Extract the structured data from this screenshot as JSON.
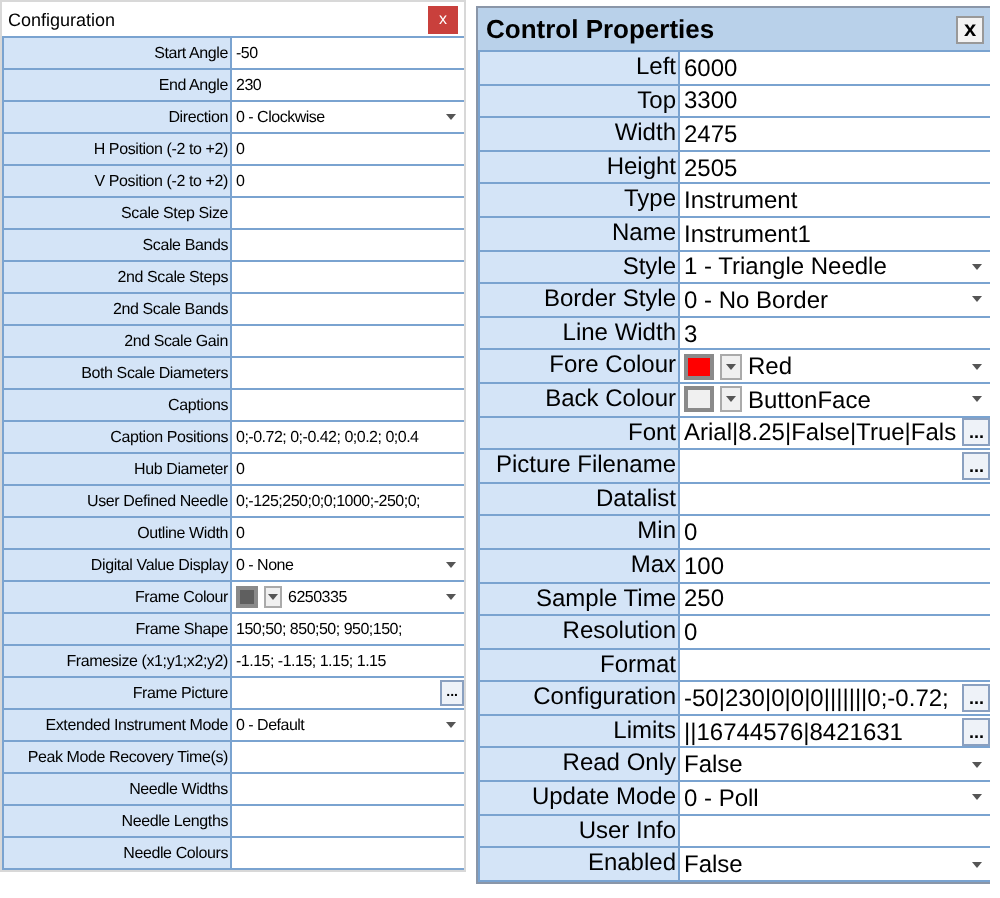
{
  "configuration": {
    "title": "Configuration",
    "close": "x",
    "rows": [
      {
        "label": "Start Angle",
        "kind": "text",
        "value": "-50"
      },
      {
        "label": "End Angle",
        "kind": "text",
        "value": "230"
      },
      {
        "label": "Direction",
        "kind": "dropdown",
        "value": "0 - Clockwise"
      },
      {
        "label": "H Position (-2 to +2)",
        "kind": "text",
        "value": "0"
      },
      {
        "label": "V Position (-2 to +2)",
        "kind": "text",
        "value": "0"
      },
      {
        "label": "Scale Step Size",
        "kind": "text"
      },
      {
        "label": "Scale Bands",
        "kind": "text"
      },
      {
        "label": "2nd Scale Steps",
        "kind": "text"
      },
      {
        "label": "2nd Scale Bands",
        "kind": "text"
      },
      {
        "label": "2nd Scale Gain",
        "kind": "text"
      },
      {
        "label": "Both Scale Diameters",
        "kind": "text"
      },
      {
        "label": "Captions",
        "kind": "text"
      },
      {
        "label": "Caption Positions",
        "kind": "text",
        "value": "0;-0.72; 0;-0.42; 0;0.2; 0;0.4"
      },
      {
        "label": "Hub Diameter",
        "kind": "text",
        "value": "0"
      },
      {
        "label": "User Defined Needle",
        "kind": "text",
        "value": "0;-125;250;0;0;1000;-250;0;"
      },
      {
        "label": "Outline Width",
        "kind": "text",
        "value": "0"
      },
      {
        "label": "Digital Value Display",
        "kind": "dropdown",
        "value": "0 - None"
      },
      {
        "label": "Frame Colour",
        "kind": "colour",
        "color": "#5f5f5f",
        "value": "6250335"
      },
      {
        "label": "Frame Shape",
        "kind": "text",
        "value": "150;50; 850;50; 950;150;"
      },
      {
        "label": "Framesize (x1;y1;x2;y2)",
        "kind": "text",
        "value": "-1.15; -1.15; 1.15; 1.15"
      },
      {
        "label": "Frame Picture",
        "kind": "ellipsis",
        "button": "..."
      },
      {
        "label": "Extended Instrument Mode",
        "kind": "dropdown",
        "value": "0 - Default"
      },
      {
        "label": "Peak Mode Recovery Time(s)",
        "kind": "text"
      },
      {
        "label": "Needle Widths",
        "kind": "text"
      },
      {
        "label": "Needle Lengths",
        "kind": "text"
      },
      {
        "label": "Needle Colours",
        "kind": "text"
      }
    ]
  },
  "control_properties": {
    "title": "Control Properties",
    "close": "x",
    "rows": [
      {
        "label": "Left",
        "kind": "text",
        "value": "6000"
      },
      {
        "label": "Top",
        "kind": "text",
        "value": "3300"
      },
      {
        "label": "Width",
        "kind": "text",
        "value": "2475"
      },
      {
        "label": "Height",
        "kind": "text",
        "value": "2505"
      },
      {
        "label": "Type",
        "kind": "text",
        "value": "Instrument"
      },
      {
        "label": "Name",
        "kind": "text",
        "value": "Instrument1"
      },
      {
        "label": "Style",
        "kind": "dropdown",
        "value": "1 - Triangle Needle"
      },
      {
        "label": "Border Style",
        "kind": "dropdown",
        "value": "0 - No Border"
      },
      {
        "label": "Line Width",
        "kind": "text",
        "value": "3"
      },
      {
        "label": "Fore Colour",
        "kind": "colour",
        "color": "#ff0000",
        "value": "Red"
      },
      {
        "label": "Back Colour",
        "kind": "colour",
        "color": "#f0f0f0",
        "value": "ButtonFace"
      },
      {
        "label": "Font",
        "kind": "ellipsis",
        "value": "Arial|8.25|False|True|Fals",
        "button": "..."
      },
      {
        "label": "Picture Filename",
        "kind": "ellipsis",
        "button": "..."
      },
      {
        "label": "Datalist",
        "kind": "text"
      },
      {
        "label": "Min",
        "kind": "text",
        "value": "0"
      },
      {
        "label": "Max",
        "kind": "text",
        "value": "100"
      },
      {
        "label": "Sample Time",
        "kind": "text",
        "value": "250"
      },
      {
        "label": "Resolution",
        "kind": "text",
        "value": "0"
      },
      {
        "label": "Format",
        "kind": "text"
      },
      {
        "label": "Configuration",
        "kind": "ellipsis",
        "value": "-50|230|0|0|0|||||||0;-0.72;",
        "button": "..."
      },
      {
        "label": "Limits",
        "kind": "ellipsis",
        "value": "||16744576|8421631",
        "button": "..."
      },
      {
        "label": "Read Only",
        "kind": "dropdown",
        "value": "False"
      },
      {
        "label": "Update Mode",
        "kind": "dropdown",
        "value": "0 - Poll"
      },
      {
        "label": "User Info",
        "kind": "text"
      },
      {
        "label": "Enabled",
        "kind": "dropdown",
        "value": "False"
      }
    ]
  }
}
